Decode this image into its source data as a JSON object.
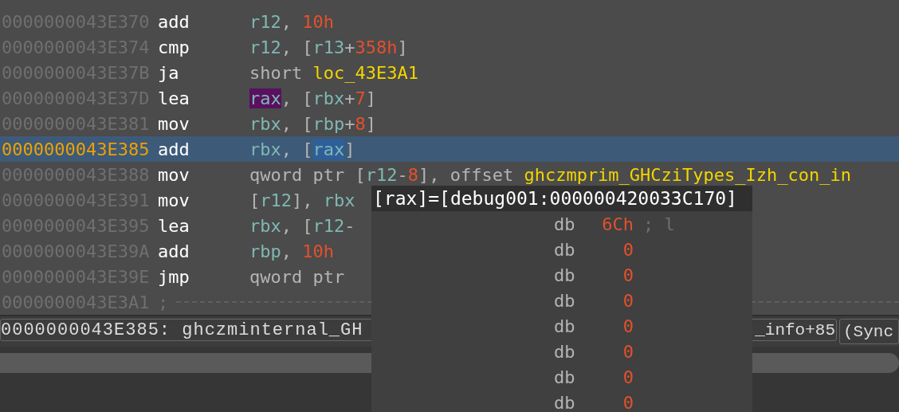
{
  "listing": {
    "rows": [
      {
        "address": "0000000043E370",
        "current": false,
        "mnemonic": "add",
        "operands": [
          {
            "text": "r12",
            "kind": "reg"
          },
          {
            "text": ", ",
            "kind": "plain"
          },
          {
            "text": "10h",
            "kind": "num"
          }
        ]
      },
      {
        "address": "0000000043E374",
        "current": false,
        "mnemonic": "cmp",
        "operands": [
          {
            "text": "r12",
            "kind": "reg"
          },
          {
            "text": ", [",
            "kind": "plain"
          },
          {
            "text": "r13",
            "kind": "reg"
          },
          {
            "text": "+",
            "kind": "plain"
          },
          {
            "text": "358h",
            "kind": "num"
          },
          {
            "text": "]",
            "kind": "plain"
          }
        ]
      },
      {
        "address": "0000000043E37B",
        "current": false,
        "mnemonic": "ja",
        "operands": [
          {
            "text": "short ",
            "kind": "plain"
          },
          {
            "text": "loc_43E3A1",
            "kind": "label"
          }
        ]
      },
      {
        "address": "0000000043E37D",
        "current": false,
        "mnemonic": "lea",
        "operands": [
          {
            "text": "rax",
            "kind": "reg",
            "color": "#5a1060"
          },
          {
            "text": ", [",
            "kind": "plain"
          },
          {
            "text": "rbx",
            "kind": "reg"
          },
          {
            "text": "+",
            "kind": "plain"
          },
          {
            "text": "7",
            "kind": "num"
          },
          {
            "text": "]",
            "kind": "plain"
          }
        ]
      },
      {
        "address": "0000000043E381",
        "current": false,
        "mnemonic": "mov",
        "operands": [
          {
            "text": "rbx",
            "kind": "reg"
          },
          {
            "text": ", [",
            "kind": "plain"
          },
          {
            "text": "rbp",
            "kind": "reg"
          },
          {
            "text": "+",
            "kind": "plain"
          },
          {
            "text": "8",
            "kind": "num"
          },
          {
            "text": "]",
            "kind": "plain"
          }
        ]
      },
      {
        "address": "0000000043E385",
        "current": true,
        "mnemonic": "add",
        "operands": [
          {
            "text": "rbx",
            "kind": "reg"
          },
          {
            "text": ", [",
            "kind": "plain"
          },
          {
            "text": "rax",
            "kind": "reg",
            "color": "#2f5f9a"
          },
          {
            "text": "]",
            "kind": "plain"
          }
        ]
      },
      {
        "address": "0000000043E388",
        "current": false,
        "mnemonic": "mov",
        "operands": [
          {
            "text": "qword ptr [",
            "kind": "plain"
          },
          {
            "text": "r12",
            "kind": "reg"
          },
          {
            "text": "-",
            "kind": "plain"
          },
          {
            "text": "8",
            "kind": "num"
          },
          {
            "text": "], offset ",
            "kind": "plain"
          },
          {
            "text": "ghczmprim_GHCziTypes_Izh_con_in",
            "kind": "label"
          }
        ]
      },
      {
        "address": "0000000043E391",
        "current": false,
        "mnemonic": "mov",
        "operands": [
          {
            "text": "[",
            "kind": "plain"
          },
          {
            "text": "r12",
            "kind": "reg"
          },
          {
            "text": "], ",
            "kind": "plain"
          },
          {
            "text": "rbx",
            "kind": "reg"
          }
        ]
      },
      {
        "address": "0000000043E395",
        "current": false,
        "mnemonic": "lea",
        "operands": [
          {
            "text": "rbx",
            "kind": "reg"
          },
          {
            "text": ", [",
            "kind": "plain"
          },
          {
            "text": "r12",
            "kind": "reg"
          },
          {
            "text": "-",
            "kind": "plain"
          }
        ]
      },
      {
        "address": "0000000043E39A",
        "current": false,
        "mnemonic": "add",
        "operands": [
          {
            "text": "rbp",
            "kind": "reg"
          },
          {
            "text": ", ",
            "kind": "plain"
          },
          {
            "text": "10h",
            "kind": "num"
          }
        ]
      },
      {
        "address": "0000000043E39E",
        "current": false,
        "mnemonic": "jmp",
        "operands": [
          {
            "text": "qword ptr",
            "kind": "plain"
          }
        ]
      },
      {
        "address": "0000000043E3A1",
        "current": false,
        "separator": ";"
      }
    ]
  },
  "status_bar": {
    "location": "0000000043E385: ghczminternal_GH",
    "offset": "_info+85",
    "mode": "(Sync"
  },
  "hint": {
    "title": "[rax]=[debug001:000000420033C170]",
    "rows": [
      {
        "directive": "db",
        "value": "6Ch",
        "comment": "; l"
      },
      {
        "directive": "db",
        "value": "0"
      },
      {
        "directive": "db",
        "value": "0"
      },
      {
        "directive": "db",
        "value": "0"
      },
      {
        "directive": "db",
        "value": "0"
      },
      {
        "directive": "db",
        "value": "0"
      },
      {
        "directive": "db",
        "value": "0"
      },
      {
        "directive": "db",
        "value": "0"
      }
    ]
  }
}
